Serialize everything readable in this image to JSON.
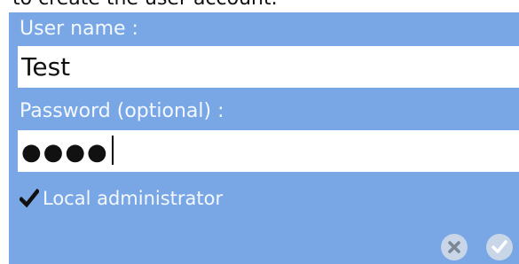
{
  "intro": {
    "text": "to create the user account."
  },
  "form": {
    "username_label": "User name :",
    "username_value": "Test",
    "password_label": "Password (optional) :",
    "password_masked": "●●●●",
    "local_admin_label": "Local administrator",
    "local_admin_checked": true
  },
  "actions": {
    "cancel_icon": "close-icon",
    "confirm_icon": "checkmark-icon"
  },
  "colors": {
    "panel": "#79a7e6",
    "label_text": "#f4f8ff",
    "button": "#c8d6e8",
    "button_icon": "#7b8796"
  }
}
